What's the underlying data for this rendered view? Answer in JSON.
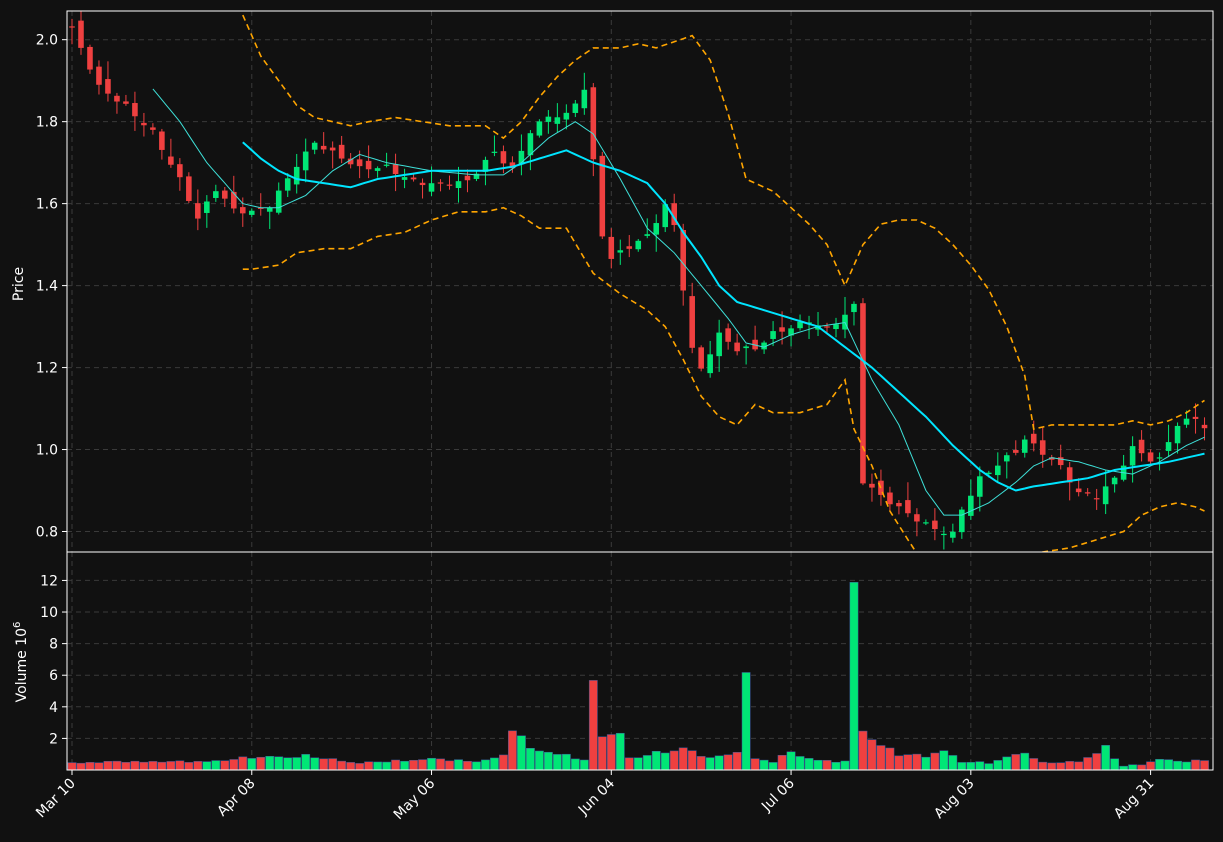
{
  "colors": {
    "background": "#111111",
    "up": "#00e676",
    "down": "#ef4040",
    "ma_fast": "#3ee0d8",
    "ma_slow": "#00e5ff",
    "band": "#ffa500",
    "grid": "#3a3a3a",
    "axis": "#ffffff"
  },
  "chart_data": {
    "type": "candlestick",
    "title": "",
    "grid": true,
    "price_panel": {
      "ylabel": "Price",
      "ylim": [
        0.75,
        2.07
      ],
      "yticks": [
        "0.8",
        "1.0",
        "1.2",
        "1.4",
        "1.6",
        "1.8",
        "2.0"
      ]
    },
    "volume_panel": {
      "ylabel": "Volume  10",
      "ylabel_exponent": "6",
      "ylim": [
        0,
        13.8
      ],
      "yticks": [
        "2",
        "4",
        "6",
        "8",
        "10",
        "12"
      ]
    },
    "x_tick_labels": [
      "Mar 10",
      "Apr 08",
      "May 06",
      "Jun 04",
      "Jul 06",
      "Aug 03",
      "Aug 31"
    ],
    "x_tick_positions": [
      0,
      20,
      40,
      60,
      80,
      100,
      120
    ],
    "n_sessions": 127,
    "anchors": {
      "close": [
        [
          0,
          2.02
        ],
        [
          3,
          1.88
        ],
        [
          6,
          1.84
        ],
        [
          9,
          1.78
        ],
        [
          12,
          1.66
        ],
        [
          14,
          1.56
        ],
        [
          16,
          1.63
        ],
        [
          18,
          1.58
        ],
        [
          20,
          1.58
        ],
        [
          22,
          1.6
        ],
        [
          25,
          1.7
        ],
        [
          27,
          1.75
        ],
        [
          29,
          1.72
        ],
        [
          32,
          1.68
        ],
        [
          35,
          1.69
        ],
        [
          38,
          1.66
        ],
        [
          41,
          1.65
        ],
        [
          44,
          1.65
        ],
        [
          47,
          1.72
        ],
        [
          49,
          1.68
        ],
        [
          51,
          1.78
        ],
        [
          53,
          1.82
        ],
        [
          55,
          1.82
        ],
        [
          57,
          1.88
        ],
        [
          59,
          1.52
        ],
        [
          60,
          1.46
        ],
        [
          62,
          1.49
        ],
        [
          64,
          1.52
        ],
        [
          66,
          1.6
        ],
        [
          67,
          1.55
        ],
        [
          69,
          1.25
        ],
        [
          70,
          1.2
        ],
        [
          72,
          1.28
        ],
        [
          74,
          1.24
        ],
        [
          76,
          1.24
        ],
        [
          78,
          1.28
        ],
        [
          80,
          1.3
        ],
        [
          82,
          1.32
        ],
        [
          84,
          1.3
        ],
        [
          86,
          1.33
        ],
        [
          87,
          1.35
        ],
        [
          88,
          0.92
        ],
        [
          90,
          0.88
        ],
        [
          93,
          0.84
        ],
        [
          96,
          0.81
        ],
        [
          98,
          0.8
        ],
        [
          99,
          0.86
        ],
        [
          101,
          0.93
        ],
        [
          103,
          0.96
        ],
        [
          105,
          0.99
        ],
        [
          106,
          1.02
        ],
        [
          108,
          0.99
        ],
        [
          110,
          0.96
        ],
        [
          112,
          0.9
        ],
        [
          114,
          0.89
        ],
        [
          116,
          0.93
        ],
        [
          118,
          1.0
        ],
        [
          120,
          0.97
        ],
        [
          121,
          0.97
        ],
        [
          123,
          1.06
        ],
        [
          125,
          1.08
        ],
        [
          126,
          1.06
        ]
      ],
      "ma_fast": [
        [
          9,
          1.88
        ],
        [
          12,
          1.8
        ],
        [
          15,
          1.7
        ],
        [
          19,
          1.6
        ],
        [
          21,
          1.59
        ],
        [
          23,
          1.59
        ],
        [
          26,
          1.62
        ],
        [
          29,
          1.68
        ],
        [
          32,
          1.72
        ],
        [
          35,
          1.7
        ],
        [
          40,
          1.68
        ],
        [
          45,
          1.67
        ],
        [
          48,
          1.67
        ],
        [
          50,
          1.7
        ],
        [
          53,
          1.76
        ],
        [
          56,
          1.8
        ],
        [
          58,
          1.77
        ],
        [
          61,
          1.66
        ],
        [
          64,
          1.54
        ],
        [
          67,
          1.48
        ],
        [
          70,
          1.4
        ],
        [
          73,
          1.32
        ],
        [
          75,
          1.26
        ],
        [
          77,
          1.25
        ],
        [
          80,
          1.28
        ],
        [
          83,
          1.3
        ],
        [
          86,
          1.31
        ],
        [
          89,
          1.17
        ],
        [
          92,
          1.06
        ],
        [
          95,
          0.9
        ],
        [
          97,
          0.84
        ],
        [
          99,
          0.84
        ],
        [
          102,
          0.87
        ],
        [
          105,
          0.92
        ],
        [
          107,
          0.96
        ],
        [
          109,
          0.98
        ],
        [
          112,
          0.97
        ],
        [
          115,
          0.95
        ],
        [
          118,
          0.94
        ],
        [
          121,
          0.97
        ],
        [
          124,
          1.01
        ],
        [
          126,
          1.03
        ]
      ],
      "ma_slow": [
        [
          19,
          1.75
        ],
        [
          21,
          1.71
        ],
        [
          23,
          1.68
        ],
        [
          25,
          1.66
        ],
        [
          28,
          1.65
        ],
        [
          31,
          1.64
        ],
        [
          34,
          1.66
        ],
        [
          37,
          1.67
        ],
        [
          40,
          1.68
        ],
        [
          43,
          1.68
        ],
        [
          46,
          1.68
        ],
        [
          49,
          1.69
        ],
        [
          52,
          1.71
        ],
        [
          55,
          1.73
        ],
        [
          58,
          1.7
        ],
        [
          61,
          1.68
        ],
        [
          64,
          1.65
        ],
        [
          66,
          1.6
        ],
        [
          68,
          1.53
        ],
        [
          70,
          1.47
        ],
        [
          72,
          1.4
        ],
        [
          74,
          1.36
        ],
        [
          77,
          1.34
        ],
        [
          80,
          1.32
        ],
        [
          83,
          1.3
        ],
        [
          86,
          1.25
        ],
        [
          89,
          1.2
        ],
        [
          92,
          1.14
        ],
        [
          95,
          1.08
        ],
        [
          98,
          1.01
        ],
        [
          101,
          0.95
        ],
        [
          103,
          0.92
        ],
        [
          105,
          0.9
        ],
        [
          107,
          0.91
        ],
        [
          110,
          0.92
        ],
        [
          113,
          0.93
        ],
        [
          116,
          0.95
        ],
        [
          119,
          0.96
        ],
        [
          122,
          0.97
        ],
        [
          124,
          0.98
        ],
        [
          126,
          0.99
        ]
      ],
      "band_upper": [
        [
          19,
          2.06
        ],
        [
          21,
          1.96
        ],
        [
          23,
          1.9
        ],
        [
          25,
          1.84
        ],
        [
          27,
          1.81
        ],
        [
          29,
          1.8
        ],
        [
          31,
          1.79
        ],
        [
          33,
          1.8
        ],
        [
          36,
          1.81
        ],
        [
          39,
          1.8
        ],
        [
          42,
          1.79
        ],
        [
          46,
          1.79
        ],
        [
          48,
          1.76
        ],
        [
          50,
          1.8
        ],
        [
          52,
          1.86
        ],
        [
          54,
          1.91
        ],
        [
          56,
          1.95
        ],
        [
          58,
          1.98
        ],
        [
          61,
          1.98
        ],
        [
          63,
          1.99
        ],
        [
          65,
          1.98
        ],
        [
          69,
          2.01
        ],
        [
          71,
          1.95
        ],
        [
          73,
          1.82
        ],
        [
          75,
          1.66
        ],
        [
          78,
          1.63
        ],
        [
          80,
          1.59
        ],
        [
          82,
          1.55
        ],
        [
          84,
          1.5
        ],
        [
          86,
          1.4
        ],
        [
          88,
          1.5
        ],
        [
          90,
          1.55
        ],
        [
          92,
          1.56
        ],
        [
          94,
          1.56
        ],
        [
          96,
          1.54
        ],
        [
          98,
          1.5
        ],
        [
          100,
          1.45
        ],
        [
          102,
          1.39
        ],
        [
          104,
          1.3
        ],
        [
          106,
          1.18
        ],
        [
          107,
          1.05
        ],
        [
          109,
          1.06
        ],
        [
          112,
          1.06
        ],
        [
          114,
          1.06
        ],
        [
          116,
          1.06
        ],
        [
          118,
          1.07
        ],
        [
          120,
          1.06
        ],
        [
          122,
          1.07
        ],
        [
          124,
          1.09
        ],
        [
          126,
          1.12
        ]
      ],
      "band_lower": [
        [
          19,
          1.44
        ],
        [
          20,
          1.44
        ],
        [
          23,
          1.45
        ],
        [
          25,
          1.48
        ],
        [
          28,
          1.49
        ],
        [
          31,
          1.49
        ],
        [
          34,
          1.52
        ],
        [
          37,
          1.53
        ],
        [
          40,
          1.56
        ],
        [
          43,
          1.58
        ],
        [
          46,
          1.58
        ],
        [
          48,
          1.59
        ],
        [
          50,
          1.57
        ],
        [
          52,
          1.54
        ],
        [
          55,
          1.54
        ],
        [
          58,
          1.43
        ],
        [
          61,
          1.38
        ],
        [
          64,
          1.34
        ],
        [
          66,
          1.3
        ],
        [
          68,
          1.22
        ],
        [
          70,
          1.13
        ],
        [
          72,
          1.08
        ],
        [
          74,
          1.06
        ],
        [
          76,
          1.11
        ],
        [
          78,
          1.09
        ],
        [
          81,
          1.09
        ],
        [
          84,
          1.11
        ],
        [
          86,
          1.17
        ],
        [
          87,
          1.05
        ],
        [
          89,
          0.96
        ],
        [
          91,
          0.85
        ],
        [
          93,
          0.78
        ],
        [
          96,
          0.68
        ],
        [
          99,
          0.62
        ],
        [
          103,
          0.62
        ],
        [
          106,
          0.74
        ],
        [
          108,
          0.75
        ],
        [
          111,
          0.76
        ],
        [
          114,
          0.78
        ],
        [
          117,
          0.8
        ],
        [
          119,
          0.84
        ],
        [
          121,
          0.86
        ],
        [
          123,
          0.87
        ],
        [
          125,
          0.86
        ],
        [
          126,
          0.85
        ]
      ],
      "volume": [
        [
          0,
          0.5
        ],
        [
          5,
          0.6
        ],
        [
          15,
          0.6
        ],
        [
          20,
          0.9
        ],
        [
          26,
          1.0
        ],
        [
          32,
          0.5
        ],
        [
          40,
          0.8
        ],
        [
          45,
          0.6
        ],
        [
          48,
          1.0
        ],
        [
          49,
          3.1
        ],
        [
          51,
          1.5
        ],
        [
          54,
          1.2
        ],
        [
          57,
          0.7
        ],
        [
          58,
          5.9
        ],
        [
          59,
          2.5
        ],
        [
          61,
          2.8
        ],
        [
          62,
          0.8
        ],
        [
          65,
          1.2
        ],
        [
          68,
          1.6
        ],
        [
          70,
          1.0
        ],
        [
          72,
          0.9
        ],
        [
          74,
          1.4
        ],
        [
          75,
          6.8
        ],
        [
          76,
          0.8
        ],
        [
          78,
          0.6
        ],
        [
          80,
          1.3
        ],
        [
          82,
          0.8
        ],
        [
          85,
          0.6
        ],
        [
          86,
          0.6
        ],
        [
          87,
          12.7
        ],
        [
          88,
          3.0
        ],
        [
          89,
          2.1
        ],
        [
          90,
          1.9
        ],
        [
          92,
          1.1
        ],
        [
          95,
          1.0
        ],
        [
          97,
          1.4
        ],
        [
          99,
          0.6
        ],
        [
          102,
          0.5
        ],
        [
          104,
          0.9
        ],
        [
          106,
          1.3
        ],
        [
          108,
          0.5
        ],
        [
          112,
          0.6
        ],
        [
          115,
          1.6
        ],
        [
          116,
          0.8
        ],
        [
          117,
          0.3
        ],
        [
          119,
          0.4
        ],
        [
          121,
          0.8
        ],
        [
          123,
          0.6
        ],
        [
          126,
          0.7
        ]
      ]
    }
  }
}
